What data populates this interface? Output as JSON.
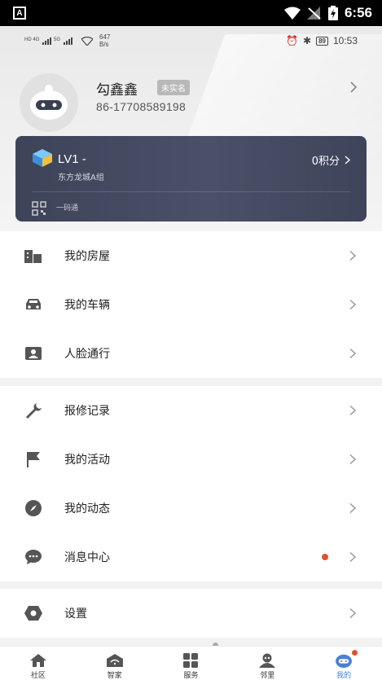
{
  "system_status": {
    "time": "6:56",
    "app_indicator": "A"
  },
  "inner_status": {
    "net_speed_value": "647",
    "net_speed_unit": "B/s",
    "battery": "89",
    "time": "10:53"
  },
  "profile": {
    "name": "勾鑫鑫",
    "badge": "未实名",
    "phone": "86-17708589198"
  },
  "card": {
    "level": "LV1 -",
    "group": "东方龙城A组",
    "points": "0积分",
    "qr_label": "一码通"
  },
  "menu_group_1": [
    {
      "label": "我的房屋",
      "icon": "building-icon"
    },
    {
      "label": "我的车辆",
      "icon": "car-icon"
    },
    {
      "label": "人脸通行",
      "icon": "face-id-icon"
    }
  ],
  "menu_group_2": [
    {
      "label": "报修记录",
      "icon": "wrench-icon"
    },
    {
      "label": "我的活动",
      "icon": "flag-icon"
    },
    {
      "label": "我的动态",
      "icon": "compass-icon"
    },
    {
      "label": "消息中心",
      "icon": "chat-icon",
      "unread": true
    }
  ],
  "menu_group_3": [
    {
      "label": "设置",
      "icon": "settings-icon"
    }
  ],
  "tabs": [
    {
      "label": "社区",
      "icon": "home-icon"
    },
    {
      "label": "智家",
      "icon": "smart-home-icon"
    },
    {
      "label": "服务",
      "icon": "grid-icon"
    },
    {
      "label": "邻里",
      "icon": "neighbors-icon"
    },
    {
      "label": "我的",
      "icon": "profile-icon",
      "active": true
    }
  ],
  "colors": {
    "accent": "#4a7fd8",
    "notification": "#e0522c",
    "card": "#444a60"
  }
}
